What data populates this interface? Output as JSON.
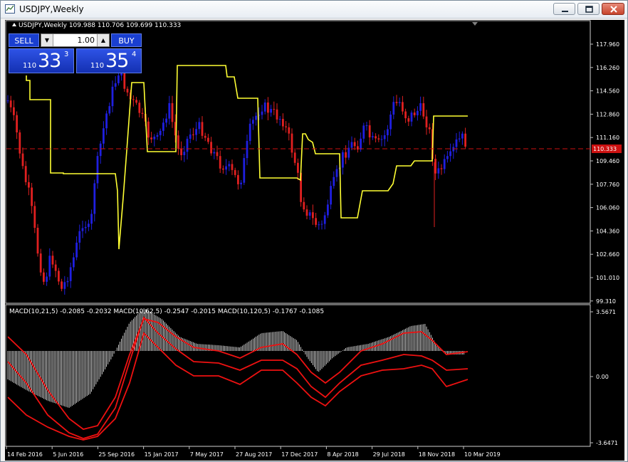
{
  "window": {
    "title": "USDJPY,Weekly",
    "controls": [
      "minimize",
      "maximize",
      "close"
    ]
  },
  "chart": {
    "header": "USDJPY,Weekly  109.988 110.706 109.699 110.333",
    "price_axis": [
      "117.960",
      "116.260",
      "114.560",
      "112.860",
      "111.160",
      "109.460",
      "107.760",
      "106.060",
      "104.360",
      "102.660",
      "101.010",
      "99.310"
    ],
    "current_price_label": "110.333",
    "macd_axis": [
      "3.5671",
      "0.00",
      "-3.6471"
    ],
    "time_axis": [
      "14 Feb 2016",
      "5 Jun 2016",
      "25 Sep 2016",
      "15 Jan 2017",
      "7 May 2017",
      "27 Aug 2017",
      "17 Dec 2017",
      "8 Apr 2018",
      "29 Jul 2018",
      "18 Nov 2018",
      "10 Mar 2019"
    ],
    "macd_label": "MACD(10,21,5) -0.2085 -0.2032  MACD(10,62,5) -0.2547 -0.2015  MACD(10,120,5) -0.1767 -0.1085",
    "colors": {
      "background": "#000000",
      "bull_candle": "#1f1fe0",
      "bear_candle": "#e02020",
      "indicator_line": "#ffff33",
      "price_line": "#cc1111",
      "macd_signal": "#ee1111",
      "macd_histogram": "#ffffff"
    }
  },
  "trade_panel": {
    "sell_label": "SELL",
    "buy_label": "BUY",
    "lot": "1.00",
    "lot_down": "▼",
    "lot_up": "▲",
    "sell_price_prefix": "110",
    "sell_price_big": "33",
    "sell_price_sup": "3",
    "buy_price_prefix": "110",
    "buy_price_big": "35",
    "buy_price_sup": "4"
  }
}
